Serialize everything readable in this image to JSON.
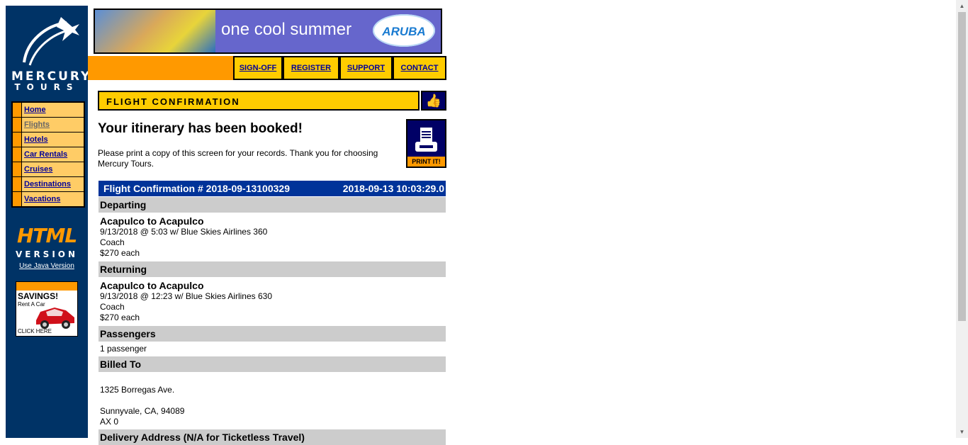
{
  "sidebar": {
    "logo_line1": "MERCURY",
    "logo_line2": "TOURS",
    "nav": [
      {
        "label": "Home"
      },
      {
        "label": "Flights"
      },
      {
        "label": "Hotels"
      },
      {
        "label": "Car Rentals"
      },
      {
        "label": "Cruises"
      },
      {
        "label": "Destinations"
      },
      {
        "label": "Vacations"
      }
    ],
    "html_version_big": "HTML",
    "html_version_small": "VERSION",
    "java_link": "Use Java Version",
    "ad": {
      "savings": "SAVINGS!",
      "rent": "Rent A Car",
      "click": "CLICK HERE"
    }
  },
  "banner": {
    "text": "one cool summer",
    "brand": "ARUBA"
  },
  "topnav": [
    {
      "label": "SIGN-OFF"
    },
    {
      "label": "REGISTER"
    },
    {
      "label": "SUPPORT"
    },
    {
      "label": "CONTACT"
    }
  ],
  "main": {
    "section_header": "FLIGHT CONFIRMATION",
    "booked_title": "Your itinerary has been booked!",
    "print_message": "Please print a copy of this screen for your records. Thank you for choosing Mercury Tours.",
    "print_label": "PRINT IT!",
    "confirmation_number": "Flight Confirmation # 2018-09-13100329",
    "timestamp": "2018-09-13 10:03:29.0",
    "departing": {
      "header": "Departing",
      "route": "Acapulco to Acapulco",
      "detail": "9/13/2018 @ 5:03 w/ Blue Skies Airlines 360",
      "class": "Coach",
      "price": "$270 each"
    },
    "returning": {
      "header": "Returning",
      "route": "Acapulco to Acapulco",
      "detail": "9/13/2018 @ 12:23 w/ Blue Skies Airlines 630",
      "class": "Coach",
      "price": "$270 each"
    },
    "passengers": {
      "header": "Passengers",
      "value": "1 passenger"
    },
    "billed_to": {
      "header": "Billed To",
      "address1": "1325 Borregas Ave.",
      "address2": "Sunnyvale, CA, 94089",
      "card": "AX 0"
    },
    "delivery_header": "Delivery Address (N/A for Ticketless Travel)"
  },
  "colors": {
    "sidebar_bg": "#003366",
    "orange": "#ff9900",
    "yellow": "#ffcc00",
    "nav_cell": "#ffcc66",
    "link": "#000099",
    "conf_bar": "#003399",
    "section_gray": "#cccccc"
  }
}
